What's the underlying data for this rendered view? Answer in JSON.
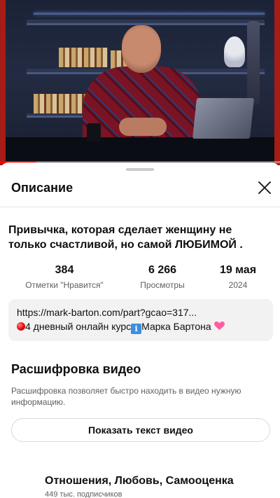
{
  "player": {
    "progress_fraction": 0.13,
    "accent_color": "#ff0000"
  },
  "sheet": {
    "title": "Описание",
    "close_icon": "close-icon"
  },
  "video": {
    "title": "Привычка, которая сделает женщину не только счастливой, но самой ЛЮБИМОЙ ."
  },
  "stats": {
    "likes": {
      "value": "384",
      "label": "Отметки \"Нравится\""
    },
    "views": {
      "value": "6 266",
      "label": "Просмотры"
    },
    "date": {
      "value": "19 мая",
      "label": "2024"
    }
  },
  "description": {
    "link": "https://mark-barton.com/part?gcao=317...",
    "line2_text": "4 дневный онлайн курс",
    "line2_author": "Марка Бартона"
  },
  "transcript": {
    "title": "Расшифровка видео",
    "description": "Расшифровка позволяет быстро находить в видео нужную информацию.",
    "button_label": "Показать текст видео"
  },
  "channel": {
    "name": "Отношения, Любовь, Самооценка",
    "subscribers": "449 тыс. подписчиков"
  }
}
